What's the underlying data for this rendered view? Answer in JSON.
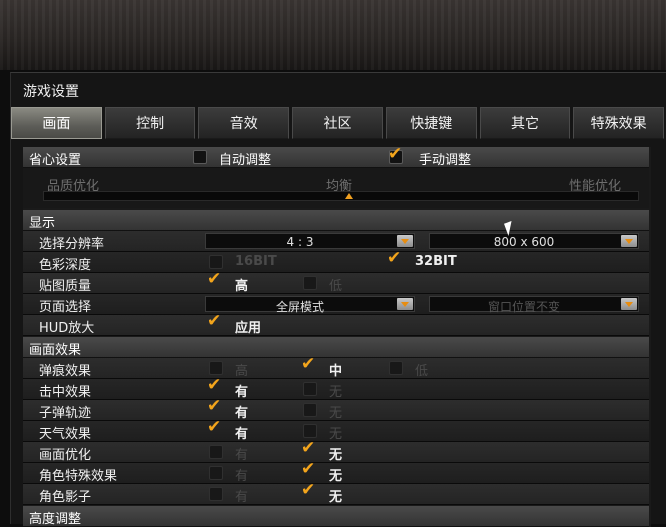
{
  "window": {
    "title": "游戏设置"
  },
  "tabs": [
    {
      "label": "画面",
      "active": true
    },
    {
      "label": "控制"
    },
    {
      "label": "音效"
    },
    {
      "label": "社区"
    },
    {
      "label": "快捷键"
    },
    {
      "label": "其它"
    },
    {
      "label": "特殊效果"
    }
  ],
  "quick": {
    "title": "省心设置",
    "auto_label": "自动调整",
    "auto_checked": false,
    "manual_label": "手动调整",
    "manual_checked": true,
    "slider_left": "品质优化",
    "slider_mid": "均衡",
    "slider_right": "性能优化",
    "slider_level": 0.5
  },
  "display": {
    "header": "显示",
    "resolution": {
      "label": "选择分辨率",
      "aspect": "4 : 3",
      "size": "800 x 600"
    },
    "color_depth": {
      "label": "色彩深度",
      "opt1": "16BIT",
      "opt1_checked": false,
      "opt2": "32BIT",
      "opt2_checked": true
    },
    "texture": {
      "label": "贴图质量",
      "opt1": "高",
      "opt1_checked": true,
      "opt2": "低",
      "opt2_checked": false
    },
    "page": {
      "label": "页面选择",
      "mode": "全屏模式",
      "window_pos": "窗口位置不变"
    },
    "hud": {
      "label": "HUD放大",
      "opt1": "应用",
      "opt1_checked": true
    }
  },
  "effects": {
    "header": "画面效果",
    "bullet_marks": {
      "label": "弹痕效果",
      "high": "高",
      "mid": "中",
      "low": "低",
      "selected": "中"
    },
    "hit": {
      "label": "击中效果",
      "yes": "有",
      "no": "无",
      "selected": "有"
    },
    "trail": {
      "label": "子弹轨迹",
      "yes": "有",
      "no": "无",
      "selected": "有"
    },
    "weather": {
      "label": "天气效果",
      "yes": "有",
      "no": "无",
      "selected": "有"
    },
    "optimize": {
      "label": "画面优化",
      "yes": "有",
      "no": "无",
      "selected": "无"
    },
    "char_fx": {
      "label": "角色特殊效果",
      "yes": "有",
      "no": "无",
      "selected": "无"
    },
    "shadow": {
      "label": "角色影子",
      "yes": "有",
      "no": "无",
      "selected": "无"
    }
  },
  "next_header": "高度调整"
}
